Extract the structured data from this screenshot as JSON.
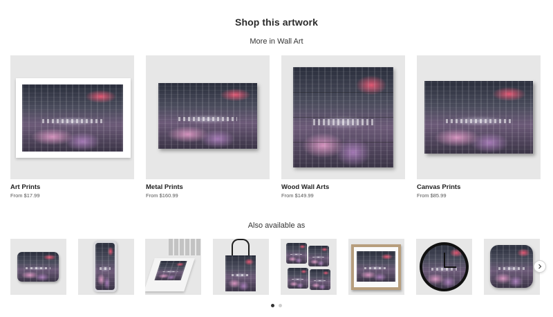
{
  "header": {
    "title": "Shop this artwork",
    "subtitle": "More in Wall Art"
  },
  "wall_art": [
    {
      "name": "Art Prints",
      "price": "From $17.99",
      "icon": "art-print"
    },
    {
      "name": "Metal Prints",
      "price": "From $160.99",
      "icon": "metal-print"
    },
    {
      "name": "Wood Wall Arts",
      "price": "From $149.99",
      "icon": "wood-wall-art"
    },
    {
      "name": "Canvas Prints",
      "price": "From $85.99",
      "icon": "canvas-print"
    }
  ],
  "also_available": {
    "heading": "Also available as",
    "items": [
      "mouse-pad",
      "phone-case",
      "laptop-skin",
      "tote-bag",
      "coasters",
      "framed-print",
      "wall-clock",
      "throw-pillow"
    ]
  },
  "carousel": {
    "next_icon": "chevron-right-icon",
    "pages": 2,
    "active_page": 1
  },
  "colors": {
    "background": "#ffffff",
    "thumb_bg": "#e7e7e7",
    "text": "#222222",
    "dot_active": "#333333",
    "dot_inactive": "#cfcfcf"
  }
}
